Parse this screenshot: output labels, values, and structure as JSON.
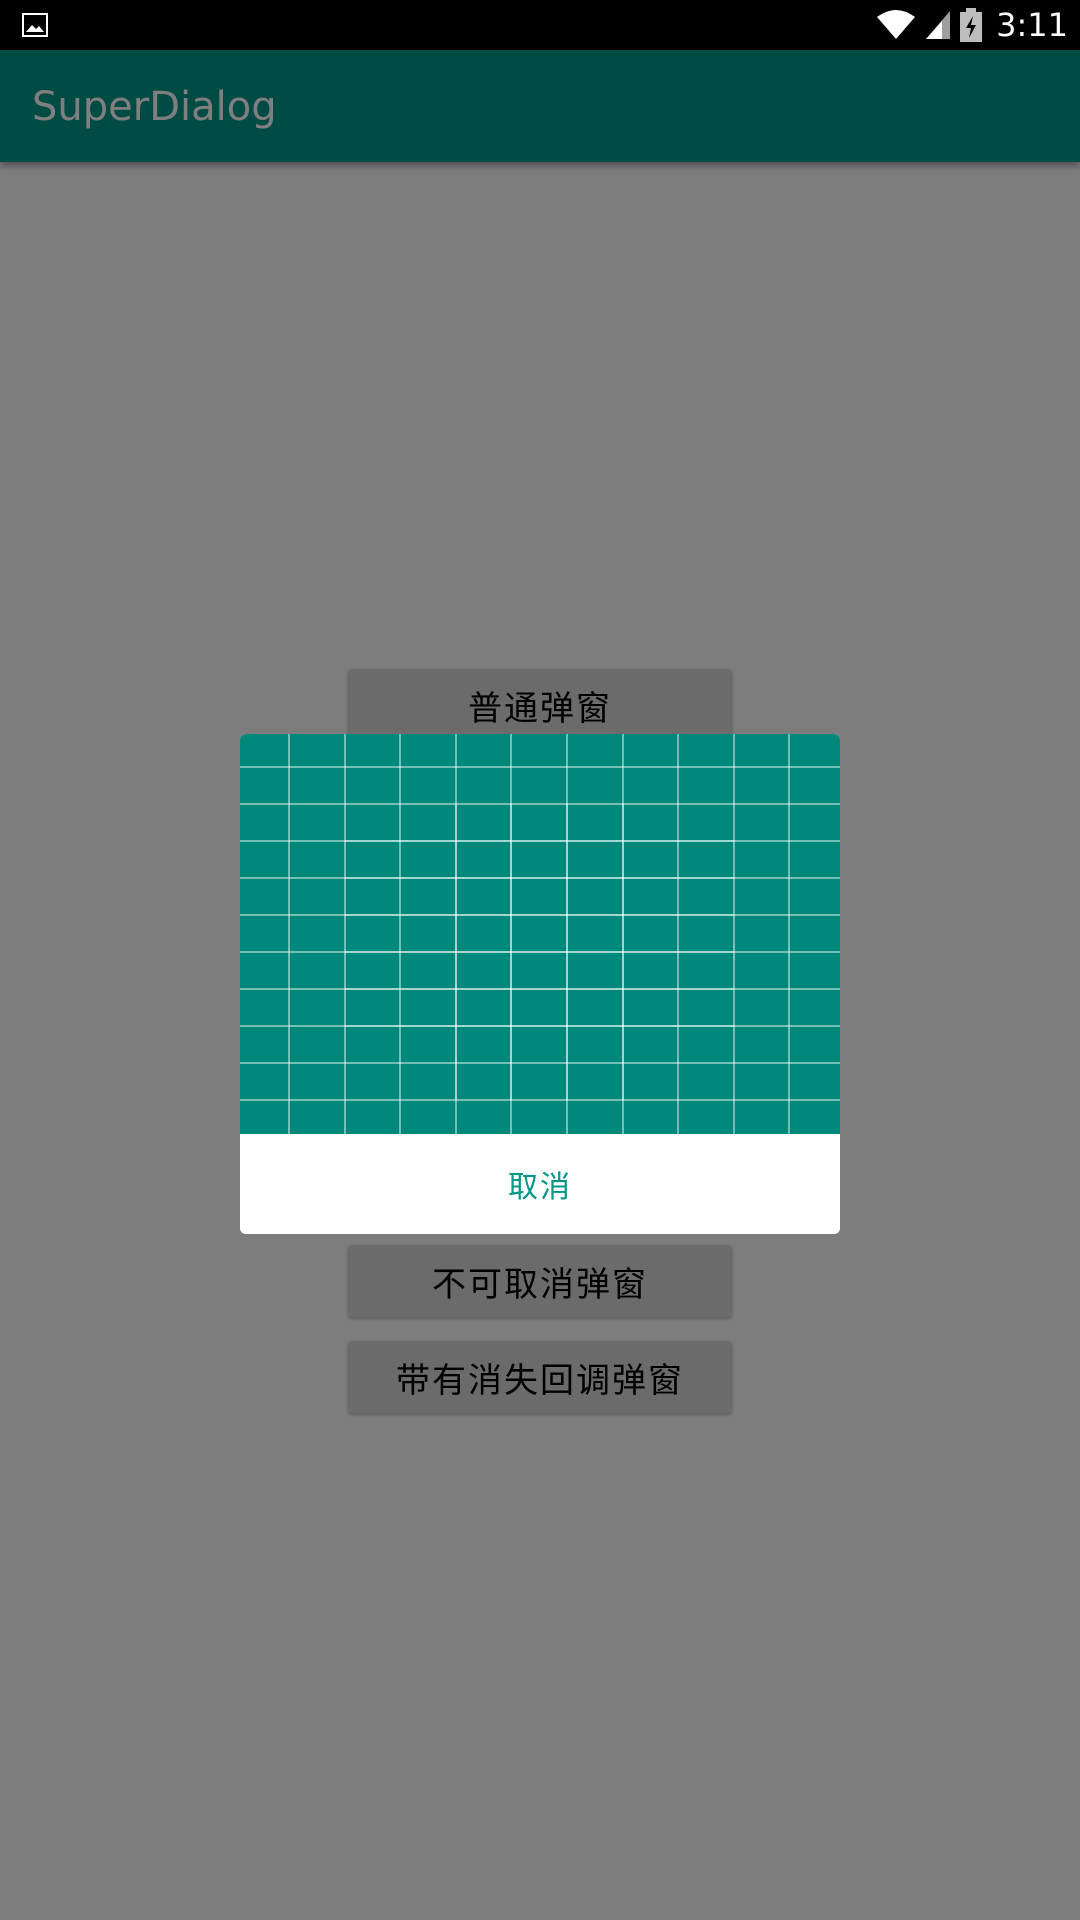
{
  "status_bar": {
    "time": "3:11",
    "icons": [
      "photo-icon",
      "wifi-icon",
      "signal-icon",
      "battery-charging-icon"
    ]
  },
  "app_bar": {
    "title": "SuperDialog"
  },
  "buttons": {
    "normal": "普通弹窗",
    "non_cancelable": "不可取消弹窗",
    "dismiss_callback": "带有消失回调弹窗"
  },
  "dialog": {
    "cancel_label": "取消"
  },
  "colors": {
    "primary": "#009688",
    "dialog_image": "#00897b",
    "scrim": "rgba(0,0,0,0.5)"
  }
}
